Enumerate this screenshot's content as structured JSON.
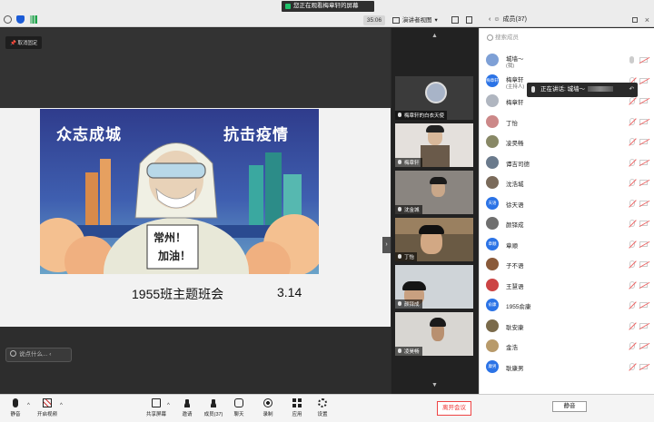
{
  "banner": {
    "text": "您正在观看梅章轩的屏幕"
  },
  "topbar": {
    "timer": "35:06",
    "view_label": "演讲者视图",
    "members_label": "成员(37)"
  },
  "main": {
    "pin_label": "取消固定",
    "chat_placeholder": "说点什么...",
    "slide": {
      "headline_left": "众志成城",
      "headline_right": "抗击疫情",
      "sign_line1": "常州！",
      "sign_line2": "加油！",
      "caption": "1955班主题班会",
      "date": "3.14"
    }
  },
  "gallery": {
    "tiles": [
      {
        "name": "梅章轩的白衣天使"
      },
      {
        "name": "梅章轩"
      },
      {
        "name": "沈金城"
      },
      {
        "name": "丁怡"
      },
      {
        "name": "颜铎成"
      },
      {
        "name": "凌昊畅"
      }
    ]
  },
  "members": {
    "search_placeholder": "搜索成员",
    "speaking_label": "正在讲话: 城墙～",
    "list": [
      {
        "name": "城墙～",
        "sub": "(我)",
        "avatar": "",
        "color": "#7ea0d6"
      },
      {
        "name": "梅章轩",
        "sub": "(主持人)",
        "avatar": "梅章轩",
        "color": "#2b73e6"
      },
      {
        "name": "梅章轩",
        "sub": "",
        "avatar": "",
        "color": "#b0b6c0"
      },
      {
        "name": "丁怡",
        "sub": "",
        "avatar": "",
        "color": "#c88"
      },
      {
        "name": "凌昊畅",
        "sub": "",
        "avatar": "",
        "color": "#886"
      },
      {
        "name": "谭吉司德",
        "sub": "",
        "avatar": "",
        "color": "#6a7a8c"
      },
      {
        "name": "沈浩城",
        "sub": "",
        "avatar": "",
        "color": "#7a6a5a"
      },
      {
        "name": "徐天语",
        "sub": "",
        "avatar": "天语",
        "color": "#2b73e6"
      },
      {
        "name": "颜铎成",
        "sub": "",
        "avatar": "",
        "color": "#6f6f6f"
      },
      {
        "name": "章顺",
        "sub": "",
        "avatar": "章顺",
        "color": "#2b73e6"
      },
      {
        "name": "子不语",
        "sub": "",
        "avatar": "",
        "color": "#8a5a3a"
      },
      {
        "name": "王慧语",
        "sub": "",
        "avatar": "",
        "color": "#c44"
      },
      {
        "name": "1955俞康",
        "sub": "",
        "avatar": "俞康",
        "color": "#2b73e6"
      },
      {
        "name": "耿安康",
        "sub": "",
        "avatar": "",
        "color": "#7a6a4a"
      },
      {
        "name": "金浩",
        "sub": "",
        "avatar": "",
        "color": "#b89a6a"
      },
      {
        "name": "耿康男",
        "sub": "",
        "avatar": "康男",
        "color": "#2b73e6"
      }
    ],
    "mute_all_label": "静音"
  },
  "toolbar": {
    "mute": "静音",
    "video": "开启视频",
    "share": "共享屏幕",
    "invite": "邀请",
    "members": "成员(37)",
    "chat": "聊天",
    "record": "录制",
    "apps": "应用",
    "settings": "设置",
    "leave": "离开会议"
  }
}
